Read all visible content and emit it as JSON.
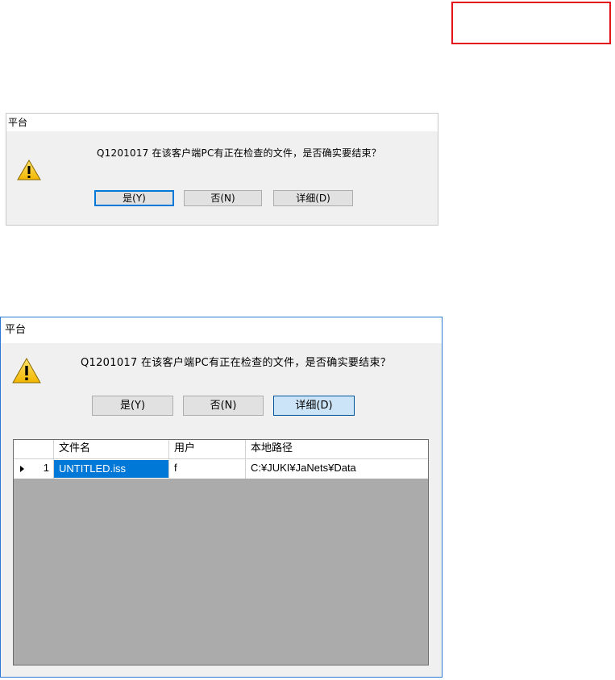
{
  "dialog_compact": {
    "title": "平台",
    "message": "Q1201017 在该客户端PC有正在检查的文件，是否确实要结束？",
    "buttons": {
      "yes": "是(Y)",
      "no": "否(N)",
      "details": "详细(D)"
    }
  },
  "dialog_expanded": {
    "title": "平台",
    "message": "Q1201017 在该客户端PC有正在检查的文件，是否确实要结束？",
    "buttons": {
      "yes": "是(Y)",
      "no": "否(N)",
      "details": "详细(D)"
    },
    "grid": {
      "columns": [
        "文件名",
        "用户",
        "本地路径"
      ],
      "rows": [
        {
          "index": "1",
          "file": "UNTITLED.iss",
          "user": "f",
          "path": "C:¥JUKI¥JaNets¥Data"
        }
      ]
    }
  },
  "colors": {
    "highlight_box": "#e3151a",
    "selection": "#0078d7",
    "dialog_border": "#2b7ad3",
    "grid_empty": "#ababab"
  },
  "icons": [
    "warning-icon",
    "row-pointer-icon"
  ]
}
